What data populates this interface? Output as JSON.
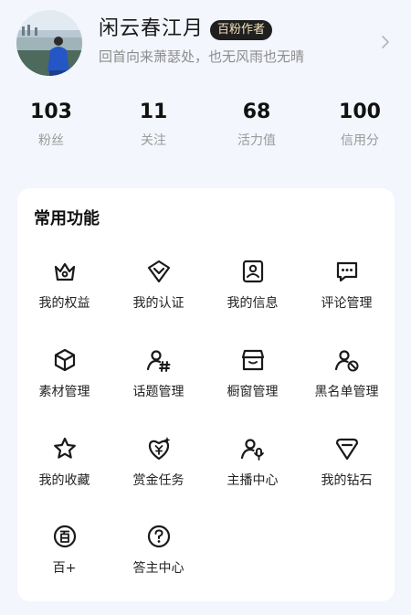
{
  "profile": {
    "name": "闲云春江月",
    "badge": "百粉作者",
    "signature": "回首向来萧瑟处，也无风雨也无晴"
  },
  "stats": [
    {
      "value": "103",
      "label": "粉丝"
    },
    {
      "value": "11",
      "label": "关注"
    },
    {
      "value": "68",
      "label": "活力值"
    },
    {
      "value": "100",
      "label": "信用分"
    }
  ],
  "section": {
    "title": "常用功能",
    "items": [
      {
        "label": "我的权益",
        "icon": "crown-icon"
      },
      {
        "label": "我的认证",
        "icon": "verified-shield-icon"
      },
      {
        "label": "我的信息",
        "icon": "id-card-icon"
      },
      {
        "label": "评论管理",
        "icon": "comment-icon"
      },
      {
        "label": "素材管理",
        "icon": "cube-icon"
      },
      {
        "label": "话题管理",
        "icon": "topic-hash-icon"
      },
      {
        "label": "橱窗管理",
        "icon": "store-icon"
      },
      {
        "label": "黑名单管理",
        "icon": "block-user-icon"
      },
      {
        "label": "我的收藏",
        "icon": "star-icon"
      },
      {
        "label": "赏金任务",
        "icon": "bounty-icon"
      },
      {
        "label": "主播中心",
        "icon": "anchor-mic-icon"
      },
      {
        "label": "我的钻石",
        "icon": "diamond-icon"
      },
      {
        "label": "百+",
        "icon": "bai-plus-icon"
      },
      {
        "label": "答主中心",
        "icon": "question-icon"
      }
    ]
  },
  "colors": {
    "background": "#f3f6fc",
    "card": "#ffffff",
    "badge_bg": "#1f1f1f",
    "badge_text": "#f6e2b8"
  }
}
